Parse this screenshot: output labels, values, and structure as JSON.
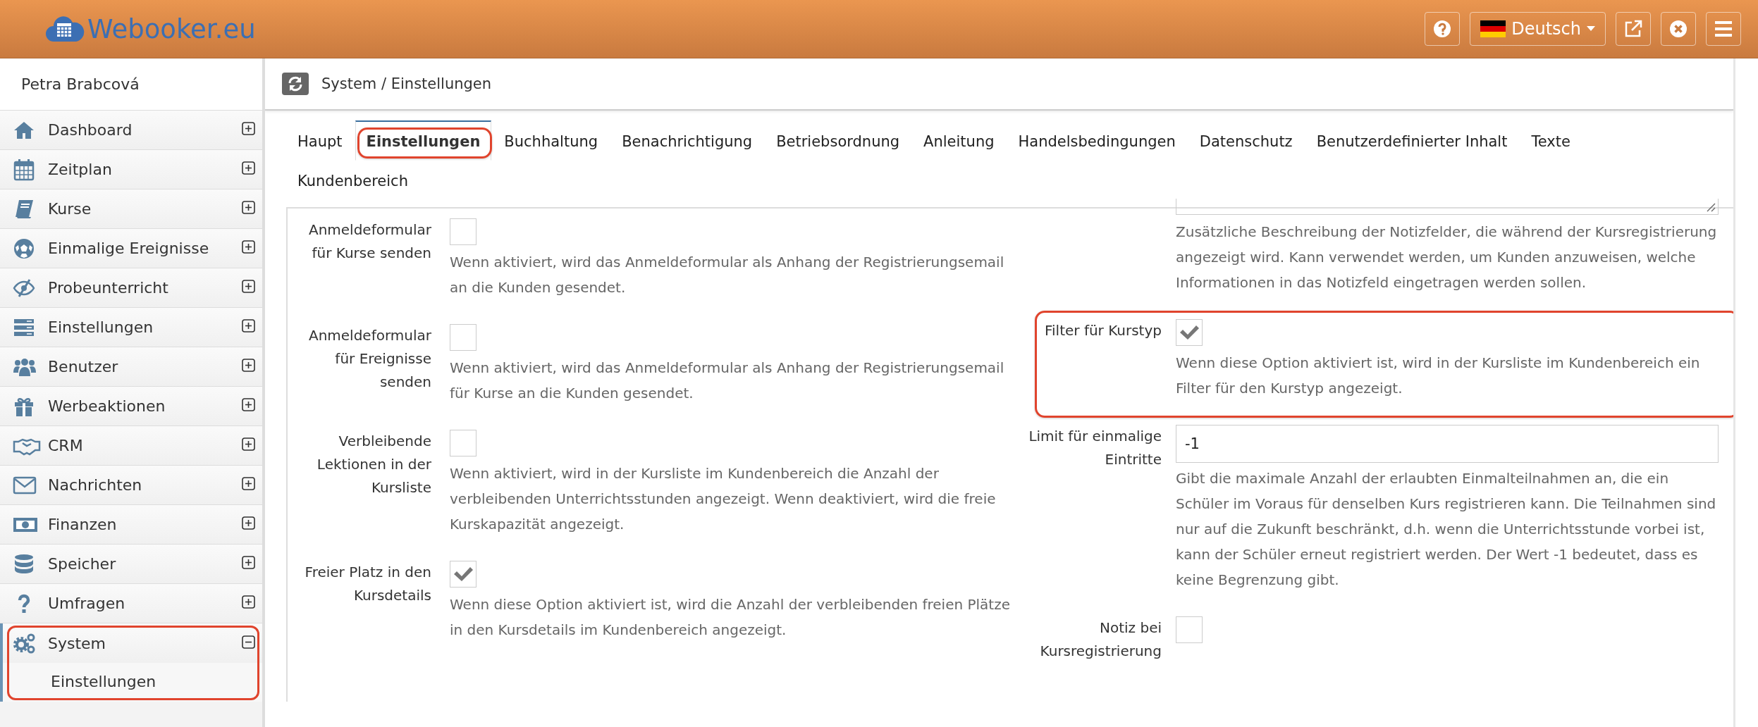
{
  "header": {
    "logo": "Webooker.eu",
    "language": "Deutsch"
  },
  "sidebar": {
    "user": "Petra Brabcová",
    "items": [
      {
        "label": "Dashboard",
        "expanded": false,
        "selected": false,
        "highlighted": false
      },
      {
        "label": "Zeitplan",
        "expanded": false,
        "selected": false,
        "highlighted": false
      },
      {
        "label": "Kurse",
        "expanded": false,
        "selected": false,
        "highlighted": false
      },
      {
        "label": "Einmalige Ereignisse",
        "expanded": false,
        "selected": false,
        "highlighted": false
      },
      {
        "label": "Probeunterricht",
        "expanded": false,
        "selected": false,
        "highlighted": false
      },
      {
        "label": "Einstellungen",
        "expanded": false,
        "selected": false,
        "highlighted": false
      },
      {
        "label": "Benutzer",
        "expanded": false,
        "selected": false,
        "highlighted": false
      },
      {
        "label": "Werbeaktionen",
        "expanded": false,
        "selected": false,
        "highlighted": false
      },
      {
        "label": "CRM",
        "expanded": false,
        "selected": false,
        "highlighted": false
      },
      {
        "label": "Nachrichten",
        "expanded": false,
        "selected": false,
        "highlighted": false
      },
      {
        "label": "Finanzen",
        "expanded": false,
        "selected": false,
        "highlighted": false
      },
      {
        "label": "Speicher",
        "expanded": false,
        "selected": false,
        "highlighted": false
      },
      {
        "label": "Umfragen",
        "expanded": false,
        "selected": false,
        "highlighted": false
      },
      {
        "label": "System",
        "expanded": true,
        "selected": true,
        "highlighted": true,
        "children": [
          {
            "label": "Einstellungen"
          }
        ]
      }
    ]
  },
  "breadcrumb": "System / Einstellungen",
  "tabs": [
    {
      "label": "Haupt",
      "selected": false,
      "highlighted": false
    },
    {
      "label": "Einstellungen",
      "selected": true,
      "highlighted": true
    },
    {
      "label": "Buchhaltung",
      "selected": false,
      "highlighted": false
    },
    {
      "label": "Benachrichtigung",
      "selected": false,
      "highlighted": false
    },
    {
      "label": "Betriebsordnung",
      "selected": false,
      "highlighted": false
    },
    {
      "label": "Anleitung",
      "selected": false,
      "highlighted": false
    },
    {
      "label": "Handelsbedingungen",
      "selected": false,
      "highlighted": false
    },
    {
      "label": "Datenschutz",
      "selected": false,
      "highlighted": false
    },
    {
      "label": "Benutzerdefinierter Inhalt",
      "selected": false,
      "highlighted": false
    },
    {
      "label": "Texte",
      "selected": false,
      "highlighted": false
    },
    {
      "label": "Kundenbereich",
      "selected": false,
      "highlighted": false
    }
  ],
  "left_settings": [
    {
      "kind": "checkbox",
      "label": "Anmeldeformular für Kurse senden",
      "checked": false,
      "highlighted": false,
      "description": "Wenn aktiviert, wird das Anmeldeformular als Anhang der Registrierungsemail an die Kunden gesendet."
    },
    {
      "kind": "checkbox",
      "label": "Anmeldeformular für Ereignisse senden",
      "checked": false,
      "highlighted": false,
      "description": "Wenn aktiviert, wird das Anmeldeformular als Anhang der Registrierungsemail für Kurse an die Kunden gesendet."
    },
    {
      "kind": "checkbox",
      "label": "Verbleibende Lektionen in der Kursliste",
      "checked": false,
      "highlighted": false,
      "description": "Wenn aktiviert, wird in der Kursliste im Kundenbereich die Anzahl der verbleibenden Unterrichtsstunden angezeigt. Wenn deaktiviert, wird die freie Kurskapazität angezeigt."
    },
    {
      "kind": "checkbox",
      "label": "Freier Platz in den Kursdetails",
      "checked": true,
      "highlighted": false,
      "description": "Wenn diese Option aktiviert ist, wird die Anzahl der verbleibenden freien Plätze in den Kursdetails im Kundenbereich angezeigt."
    }
  ],
  "right_settings": [
    {
      "kind": "textarea",
      "highlighted": false,
      "description": "Zusätzliche Beschreibung der Notizfelder, die während der Kursregistrierung angezeigt wird. Kann verwendet werden, um Kunden anzuweisen, welche Informationen in das Notizfeld eingetragen werden sollen."
    },
    {
      "kind": "checkbox",
      "label": "Filter für Kurstyp",
      "checked": true,
      "highlighted": true,
      "description": "Wenn diese Option aktiviert ist, wird in der Kursliste im Kundenbereich ein Filter für den Kurstyp angezeigt."
    },
    {
      "kind": "text",
      "label": "Limit für einmalige Eintritte",
      "value": "-1",
      "highlighted": false,
      "description": "Gibt die maximale Anzahl der erlaubten Einmalteilnahmen an, die ein Schüler im Voraus für denselben Kurs registrieren kann. Die Teilnahmen sind nur auf die Zukunft beschränkt, d.h. wenn die Unterrichtsstunde vorbei ist, kann der Schüler erneut registriert werden. Der Wert -1 bedeutet, dass es keine Begrenzung gibt."
    },
    {
      "kind": "checkbox",
      "label": "Notiz bei Kursregistrierung",
      "checked": false,
      "highlighted": false
    }
  ]
}
